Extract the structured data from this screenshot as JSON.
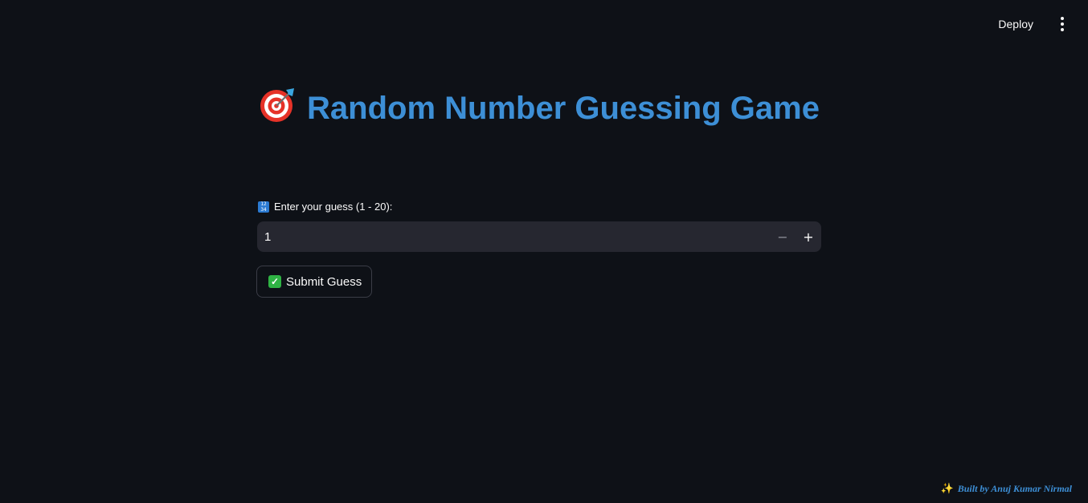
{
  "header": {
    "deploy_label": "Deploy",
    "menu_icon": "kebab-menu-icon"
  },
  "title": {
    "icon": "target-icon",
    "text": "Random Number Guessing Game"
  },
  "guess_input": {
    "label_icon": "numbers-icon",
    "label": "Enter your guess (1 - 20):",
    "value": "1",
    "minus_label": "−",
    "plus_label": "+"
  },
  "submit": {
    "icon": "check-mark-icon",
    "label": "Submit Guess"
  },
  "footer": {
    "icon": "sparkles-icon",
    "credit": "Built by Anuj Kumar Nirmal"
  },
  "colors": {
    "background": "#0e1117",
    "accent": "#3d8fd6",
    "input_bg": "#262730"
  }
}
